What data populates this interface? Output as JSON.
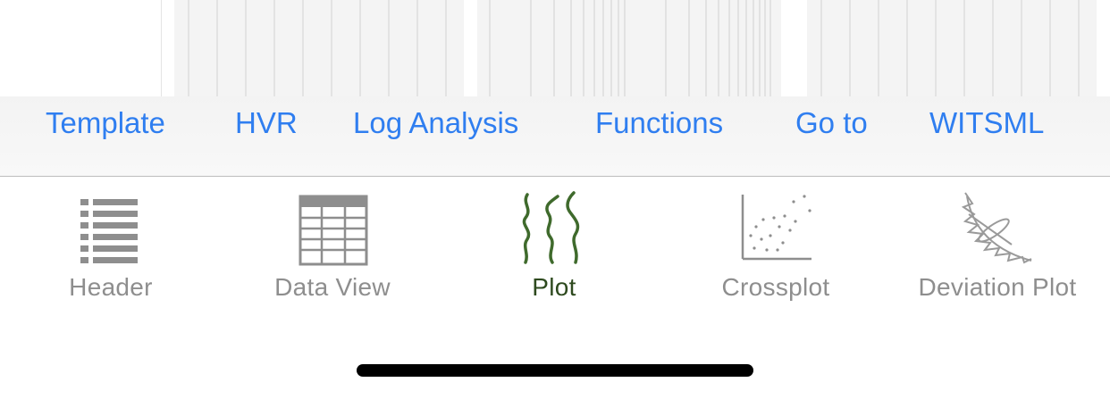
{
  "toolbar": {
    "items": [
      {
        "label": "Template"
      },
      {
        "label": "HVR"
      },
      {
        "label": "Log Analysis"
      },
      {
        "label": "Functions"
      },
      {
        "label": "Go to"
      },
      {
        "label": "WITSML"
      }
    ]
  },
  "tabs": [
    {
      "label": "Header",
      "icon": "list-icon",
      "active": false
    },
    {
      "label": "Data View",
      "icon": "table-grid-icon",
      "active": false
    },
    {
      "label": "Plot",
      "icon": "log-curves-icon",
      "active": true
    },
    {
      "label": "Crossplot",
      "icon": "scatter-plot-icon",
      "active": false
    },
    {
      "label": "Deviation Plot",
      "icon": "deviation-curve-icon",
      "active": false
    }
  ],
  "colors": {
    "accent": "#2f7ef0",
    "tab_inactive": "#8e8e8e",
    "tab_active": "#2e4a1f",
    "plot_icon_green": "#3f6a2c"
  }
}
